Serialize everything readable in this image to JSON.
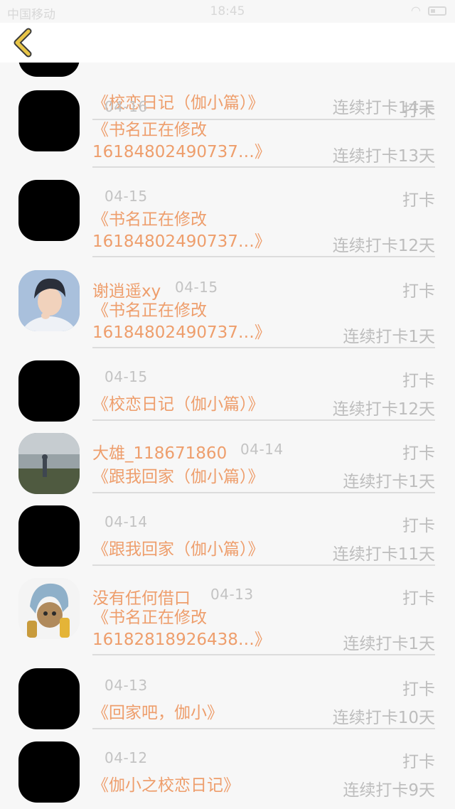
{
  "status_bar": {
    "carrier": "中国移动",
    "time": "18:45"
  },
  "entries": [
    {
      "author": "",
      "date": "",
      "checkin_label": "",
      "book": "《校恋日记（伽小篇）》",
      "streak": "连续打卡14天",
      "avatar": "black"
    },
    {
      "author": "",
      "date": "04-16",
      "checkin_label": "打卡",
      "book": "《书名正在修改\n16184802490737…》",
      "streak": "连续打卡13天",
      "avatar": "black"
    },
    {
      "author": "",
      "date": "04-15",
      "checkin_label": "打卡",
      "book": "《书名正在修改\n16184802490737…》",
      "streak": "连续打卡12天",
      "avatar": "black"
    },
    {
      "author": "谢逍遥xy",
      "date": "04-15",
      "checkin_label": "打卡",
      "book": "《书名正在修改\n16184802490737…》",
      "streak": "连续打卡1天",
      "avatar": "photo-boy"
    },
    {
      "author": "",
      "date": "04-15",
      "checkin_label": "打卡",
      "book": "《校恋日记（伽小篇）》",
      "streak": "连续打卡12天",
      "avatar": "black"
    },
    {
      "author": "大雄_118671860",
      "date": "04-14",
      "checkin_label": "打卡",
      "book": "《跟我回家（伽小篇）》",
      "streak": "连续打卡1天",
      "avatar": "photo-landscape"
    },
    {
      "author": "",
      "date": "04-14",
      "checkin_label": "打卡",
      "book": "《跟我回家（伽小篇）》",
      "streak": "连续打卡11天",
      "avatar": "black"
    },
    {
      "author": "没有任何借口",
      "date": "04-13",
      "checkin_label": "打卡",
      "book": "《书名正在修改\n16182818926438…》",
      "streak": "连续打卡1天",
      "avatar": "photo-cat"
    },
    {
      "author": "",
      "date": "04-13",
      "checkin_label": "打卡",
      "book": "《回家吧，伽小》",
      "streak": "连续打卡10天",
      "avatar": "black"
    },
    {
      "author": "",
      "date": "04-12",
      "checkin_label": "打卡",
      "book": "《伽小之校恋日记》",
      "streak": "连续打卡9天",
      "avatar": "black"
    }
  ],
  "colors": {
    "accent": "#ee9e6c",
    "muted": "#bdbdbd",
    "back_icon": "#e8c547"
  },
  "icons": {
    "back": "chevron-left-icon"
  }
}
